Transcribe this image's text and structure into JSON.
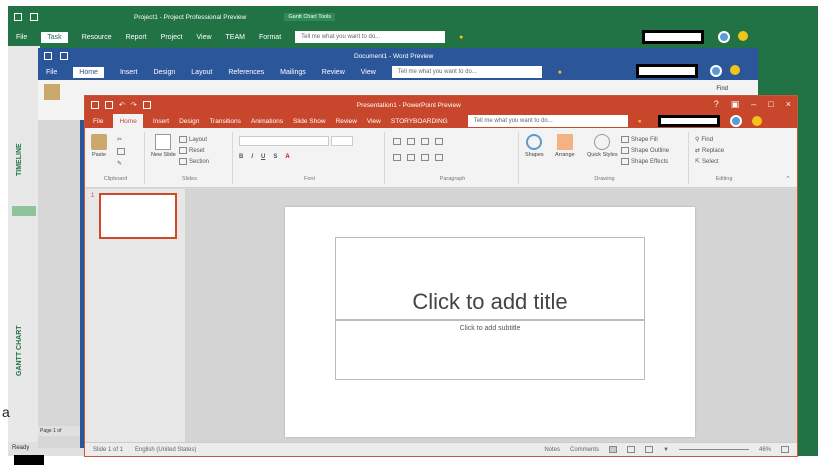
{
  "project": {
    "title": "Project1 - Project Professional Preview",
    "context_tab": "Gantt Chart Tools",
    "tabs": [
      "File",
      "Task",
      "Resource",
      "Report",
      "Project",
      "View",
      "TEAM",
      "Format"
    ],
    "active_tab": "Task",
    "tellme": "Tell me what you want to do...",
    "side_label_timeline": "TIMELINE",
    "side_label_gantt": "GANTT CHART",
    "status": "Ready",
    "page_status": "Page 1 of"
  },
  "word": {
    "title": "Document1 - Word Preview",
    "tabs": [
      "File",
      "Home",
      "Insert",
      "Design",
      "Layout",
      "References",
      "Mailings",
      "Review",
      "View"
    ],
    "active_tab": "Home",
    "tellme": "Tell me what you want to do...",
    "find": "Find"
  },
  "ppt": {
    "title": "Presentation1 - PowerPoint Preview",
    "tabs": [
      "File",
      "Home",
      "Insert",
      "Design",
      "Transitions",
      "Animations",
      "Slide Show",
      "Review",
      "View",
      "STORYBOARDING"
    ],
    "active_tab": "Home",
    "tellme": "Tell me what you want to do...",
    "ribbon": {
      "paste": "Paste",
      "clipboard": "Clipboard",
      "new_slide": "New Slide",
      "layout": "Layout",
      "reset": "Reset",
      "section": "Section",
      "slides": "Slides",
      "font": "Font",
      "paragraph": "Paragraph",
      "shapes": "Shapes",
      "arrange": "Arrange",
      "quick_styles": "Quick Styles",
      "shape_fill": "Shape Fill",
      "shape_outline": "Shape Outline",
      "shape_effects": "Shape Effects",
      "drawing": "Drawing",
      "find": "Find",
      "replace": "Replace",
      "select": "Select",
      "editing": "Editing"
    },
    "thumb_number": "1",
    "slide_title": "Click to add title",
    "slide_subtitle": "Click to add subtitle",
    "status": {
      "slide": "Slide 1 of 1",
      "language": "English (United States)",
      "notes": "Notes",
      "comments": "Comments",
      "zoom": "46%"
    }
  },
  "colors": {
    "project": "#217346",
    "word": "#2b579a",
    "powerpoint": "#c8462b"
  }
}
